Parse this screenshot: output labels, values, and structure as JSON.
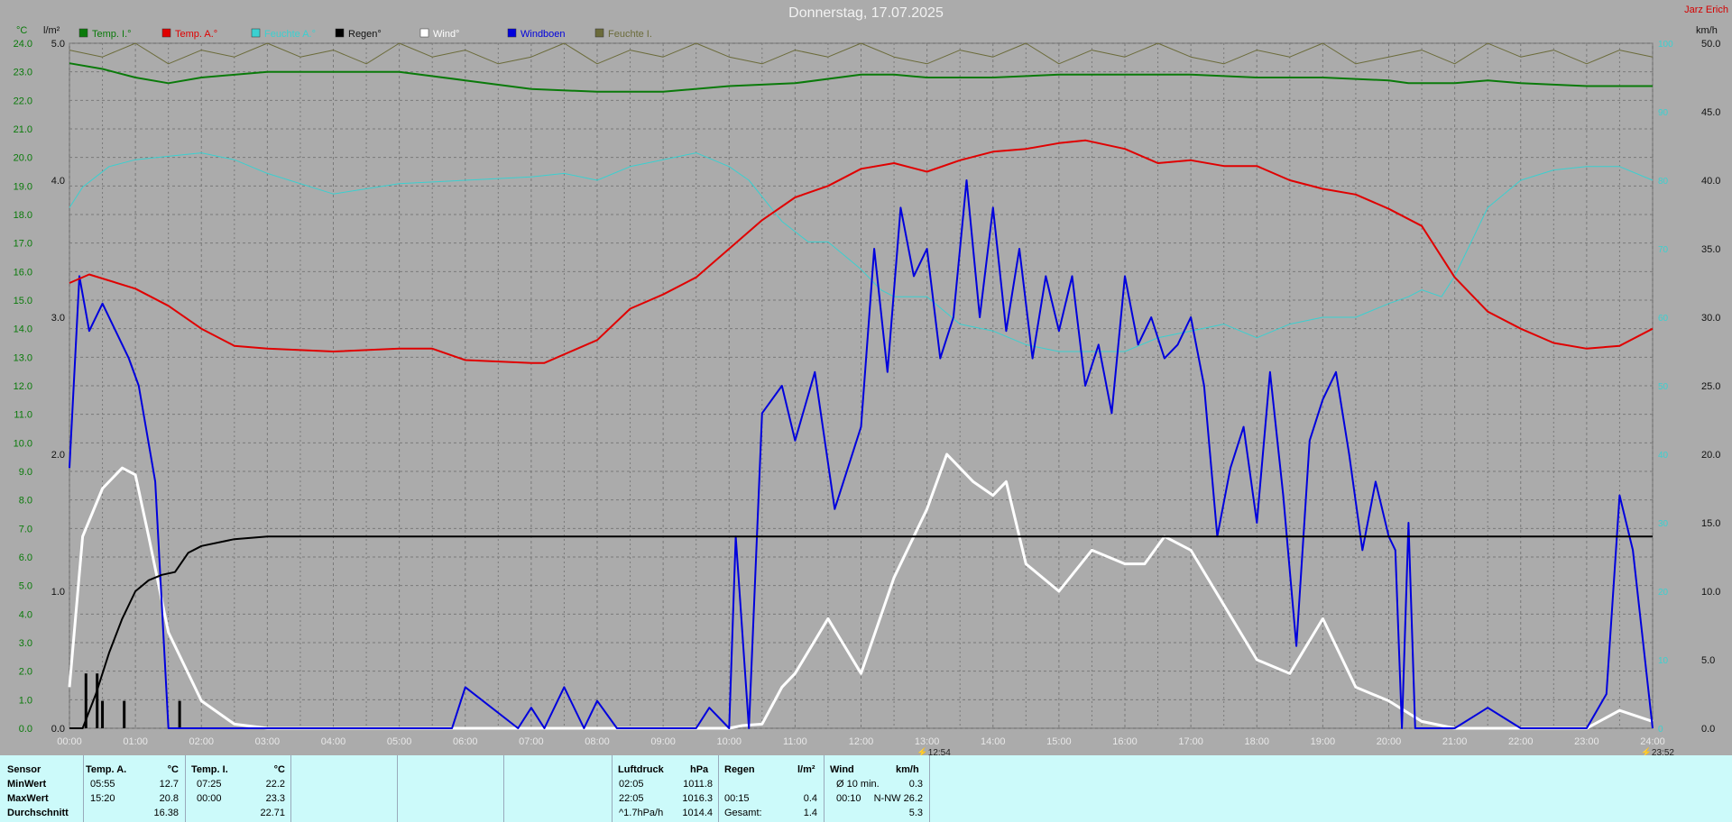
{
  "title": "Donnerstag, 17.07.2025",
  "author": "Jarz Erich",
  "units": {
    "temp": "°C",
    "rain": "l/m²",
    "wind": "km/h"
  },
  "legend": [
    {
      "label": "Temp. I.°",
      "color": "#0a7a0a"
    },
    {
      "label": "Temp. A.°",
      "color": "#e00000"
    },
    {
      "label": "Feuchte A.°",
      "color": "#3ad0d0"
    },
    {
      "label": "Regen°",
      "color": "#000000"
    },
    {
      "label": "Wind°",
      "color": "#ffffff"
    },
    {
      "label": "Windboen",
      "color": "#0000dd"
    },
    {
      "label": "Feuchte I.",
      "color": "#6b6b3a"
    }
  ],
  "markers": {
    "time1": "12:54",
    "time2": "23:52"
  },
  "chart_data": {
    "type": "line",
    "x_ticks": [
      "00:00",
      "01:00",
      "02:00",
      "03:00",
      "04:00",
      "05:00",
      "06:00",
      "07:00",
      "08:00",
      "09:00",
      "10:00",
      "11:00",
      "12:00",
      "13:00",
      "14:00",
      "15:00",
      "16:00",
      "17:00",
      "18:00",
      "19:00",
      "20:00",
      "21:00",
      "22:00",
      "23:00",
      "24:00"
    ],
    "xlim": [
      0,
      24
    ],
    "left_temp_ticks": [
      "0.0",
      "1.0",
      "2.0",
      "3.0",
      "4.0",
      "5.0",
      "6.0",
      "7.0",
      "8.0",
      "9.0",
      "10.0",
      "11.0",
      "12.0",
      "13.0",
      "14.0",
      "15.0",
      "16.0",
      "17.0",
      "18.0",
      "19.0",
      "20.0",
      "21.0",
      "22.0",
      "23.0",
      "24.0"
    ],
    "temp_lim": [
      0,
      24
    ],
    "rain_ticks": [
      "0.0",
      "1.0",
      "2.0",
      "3.0",
      "4.0",
      "5.0"
    ],
    "rain_lim": [
      0,
      5
    ],
    "wind_ticks": [
      "0.0",
      "5.0",
      "10.0",
      "15.0",
      "20.0",
      "25.0",
      "30.0",
      "35.0",
      "40.0",
      "45.0",
      "50.0"
    ],
    "wind_lim": [
      0,
      50
    ],
    "humidity_ticks": [
      "0",
      "10",
      "20",
      "30",
      "40",
      "50",
      "60",
      "70",
      "80",
      "90",
      "100"
    ],
    "series": [
      {
        "name": "Temp. I.°",
        "axis": "temp",
        "color": "#0a7a0a",
        "width": 2,
        "x": [
          0,
          0.5,
          1,
          1.5,
          2,
          3,
          4,
          5,
          6,
          7,
          8,
          9,
          10,
          11,
          12,
          12.5,
          13,
          14,
          15,
          16,
          17,
          18,
          19,
          20,
          20.3,
          21,
          21.5,
          22,
          23,
          24
        ],
        "y": [
          23.3,
          23.1,
          22.8,
          22.6,
          22.8,
          23.0,
          23.0,
          23.0,
          22.7,
          22.4,
          22.3,
          22.3,
          22.5,
          22.6,
          22.9,
          22.9,
          22.8,
          22.8,
          22.9,
          22.9,
          22.9,
          22.8,
          22.8,
          22.7,
          22.6,
          22.6,
          22.7,
          22.6,
          22.5,
          22.5
        ]
      },
      {
        "name": "Temp. A.°",
        "axis": "temp",
        "color": "#e00000",
        "width": 2,
        "x": [
          0,
          0.3,
          1,
          1.5,
          2,
          2.5,
          3,
          4,
          5,
          5.5,
          6,
          7,
          7.2,
          8,
          8.5,
          9,
          9.5,
          10,
          10.5,
          11,
          11.5,
          12,
          12.5,
          13,
          13.5,
          14,
          14.5,
          15,
          15.4,
          16,
          16.5,
          17,
          17.5,
          18,
          18.5,
          19,
          19.5,
          20,
          20.5,
          21,
          21.5,
          22,
          22.5,
          23,
          23.5,
          24
        ],
        "y": [
          15.6,
          15.9,
          15.4,
          14.8,
          14.0,
          13.4,
          13.3,
          13.2,
          13.3,
          13.3,
          12.9,
          12.8,
          12.8,
          13.6,
          14.7,
          15.2,
          15.8,
          16.8,
          17.8,
          18.6,
          19.0,
          19.6,
          19.8,
          19.5,
          19.9,
          20.2,
          20.3,
          20.5,
          20.6,
          20.3,
          19.8,
          19.9,
          19.7,
          19.7,
          19.2,
          18.9,
          18.7,
          18.2,
          17.6,
          15.8,
          14.6,
          14.0,
          13.5,
          13.3,
          13.4,
          14.0
        ]
      },
      {
        "name": "Feuchte A.°",
        "axis": "humidity",
        "color": "#3ad0d0",
        "width": 1,
        "x": [
          0,
          0.2,
          0.6,
          1,
          1.5,
          2,
          2.5,
          3,
          4,
          5,
          6,
          7,
          7.5,
          8,
          8.5,
          9,
          9.5,
          10,
          10.3,
          10.8,
          11.2,
          11.5,
          12,
          12.3,
          12.5,
          13,
          13.5,
          14,
          14.5,
          15,
          15.5,
          16,
          16.5,
          17,
          17.5,
          18,
          18.5,
          19,
          19.5,
          20,
          20.3,
          20.5,
          20.8,
          21,
          21.5,
          22,
          22.5,
          23,
          23.5,
          24
        ],
        "y": [
          76,
          79,
          82,
          83,
          83.5,
          84,
          83,
          81,
          78,
          79.5,
          80,
          80.5,
          81,
          80,
          82,
          83,
          84,
          82,
          80,
          74,
          71,
          71,
          67,
          64,
          63,
          63,
          59,
          58,
          56,
          55,
          55,
          55,
          57,
          58,
          59,
          57,
          59,
          60,
          60,
          62,
          63,
          64,
          63,
          66,
          76,
          80,
          81.5,
          82,
          82,
          80
        ]
      },
      {
        "name": "Feuchte I.",
        "axis": "humidity",
        "color": "#6b6b3a",
        "width": 1,
        "x": [
          0,
          0.5,
          1,
          1.5,
          2,
          2.5,
          3,
          3.5,
          4,
          4.5,
          5,
          5.5,
          6,
          6.5,
          7,
          7.5,
          8,
          8.5,
          9,
          9.5,
          10,
          10.5,
          11,
          11.5,
          12,
          12.5,
          13,
          13.5,
          14,
          14.5,
          15,
          15.5,
          16,
          16.5,
          17,
          17.5,
          18,
          18.5,
          19,
          19.5,
          20,
          20.5,
          21,
          21.5,
          22,
          22.5,
          23,
          23.5,
          24
        ],
        "y": [
          99,
          98,
          100,
          97,
          99,
          98,
          100,
          98,
          99,
          97,
          100,
          98,
          99,
          97,
          98,
          100,
          97,
          99,
          98,
          100,
          98,
          97,
          99,
          98,
          100,
          98,
          97,
          99,
          98,
          100,
          97,
          99,
          98,
          100,
          98,
          97,
          99,
          98,
          100,
          97,
          98,
          99,
          97,
          100,
          98,
          99,
          97,
          99,
          98
        ]
      },
      {
        "name": "Regen°",
        "axis": "rain",
        "color": "#000000",
        "width": 2,
        "x": [
          0,
          0.2,
          0.4,
          0.6,
          0.8,
          1,
          1.2,
          1.4,
          1.6,
          1.8,
          2,
          2.5,
          3,
          4,
          6,
          8,
          10,
          12,
          14,
          16,
          18,
          20,
          22,
          24
        ],
        "y": [
          0,
          0,
          0.25,
          0.55,
          0.8,
          1.0,
          1.08,
          1.12,
          1.14,
          1.28,
          1.33,
          1.38,
          1.4,
          1.4,
          1.4,
          1.4,
          1.4,
          1.4,
          1.4,
          1.4,
          1.4,
          1.4,
          1.4,
          1.4
        ]
      },
      {
        "name": "Wind°",
        "axis": "wind",
        "color": "#ffffff",
        "width": 3,
        "x": [
          0,
          0.2,
          0.5,
          0.8,
          1,
          1.2,
          1.5,
          2,
          2.5,
          3,
          10,
          10.2,
          10.5,
          10.8,
          11,
          11.5,
          12,
          12.5,
          13,
          13.3,
          13.7,
          14,
          14.2,
          14.5,
          15,
          15.5,
          16,
          16.3,
          16.6,
          17,
          17.5,
          18,
          18.5,
          19,
          19.5,
          20,
          20.5,
          21,
          22,
          23,
          23.5,
          24
        ],
        "y": [
          3,
          14,
          17.5,
          19,
          18.5,
          14,
          7,
          2,
          0.3,
          0,
          0,
          0.2,
          0.3,
          3,
          4,
          8,
          4,
          11,
          16,
          20,
          18,
          17,
          18,
          12,
          10,
          13,
          12,
          12,
          14,
          13,
          9,
          5,
          4,
          8,
          3,
          2,
          0.5,
          0,
          0,
          0,
          1.3,
          0.5
        ]
      },
      {
        "name": "Windboen",
        "axis": "wind",
        "color": "#0000dd",
        "width": 2,
        "x": [
          0,
          0.15,
          0.3,
          0.5,
          0.7,
          0.9,
          1.05,
          1.3,
          1.5,
          1.7,
          1.8,
          2,
          5,
          5.8,
          6,
          6.8,
          7,
          7.2,
          7.5,
          7.8,
          8,
          8.3,
          9.5,
          9.7,
          10,
          10.1,
          10.3,
          10.5,
          10.8,
          11,
          11.3,
          11.6,
          12,
          12.2,
          12.4,
          12.6,
          12.8,
          13,
          13.2,
          13.4,
          13.6,
          13.8,
          14,
          14.2,
          14.4,
          14.6,
          14.8,
          15,
          15.2,
          15.4,
          15.6,
          15.8,
          16,
          16.2,
          16.4,
          16.6,
          16.8,
          17,
          17.2,
          17.4,
          17.6,
          17.8,
          18,
          18.2,
          18.4,
          18.6,
          18.8,
          19,
          19.2,
          19.4,
          19.6,
          19.8,
          20,
          20.1,
          20.2,
          20.3,
          20.4,
          21,
          21.5,
          22,
          23,
          23.3,
          23.5,
          23.7,
          24
        ],
        "y": [
          19,
          33,
          29,
          31,
          29,
          27,
          25,
          18,
          0,
          0,
          0,
          0,
          0,
          0,
          3,
          0,
          1.5,
          0,
          3,
          0,
          2,
          0,
          0,
          1.5,
          0,
          14,
          0,
          23,
          25,
          21,
          26,
          16,
          22,
          35,
          26,
          38,
          33,
          35,
          27,
          30,
          40,
          30,
          38,
          29,
          35,
          27,
          33,
          29,
          33,
          25,
          28,
          23,
          33,
          28,
          30,
          27,
          28,
          30,
          25,
          14,
          19,
          22,
          15,
          26,
          17,
          6,
          21,
          24,
          26,
          20,
          13,
          18,
          14,
          13,
          0,
          15,
          0,
          0,
          1.5,
          0,
          0,
          2.5,
          17,
          13,
          0
        ]
      }
    ]
  },
  "table": {
    "headers": {
      "sensor": "Sensor",
      "temp_a": "Temp. A.",
      "temp_a_unit": "°C",
      "temp_i": "Temp. I.",
      "temp_i_unit": "°C",
      "luftdruck": "Luftdruck",
      "luftdruck_unit": "hPa",
      "regen": "Regen",
      "regen_unit": "l/m²",
      "wind": "Wind",
      "wind_unit": "km/h"
    },
    "rows": [
      {
        "label": "MinWert",
        "ta_time": "05:55",
        "ta_val": "12.7",
        "ti_time": "07:25",
        "ti_val": "22.2",
        "p_time": "02:05",
        "p_val": "1011.8",
        "r_time": "",
        "r_val": "",
        "w_time": "Ø 10 min.",
        "w_val": "0.3"
      },
      {
        "label": "MaxWert",
        "ta_time": "15:20",
        "ta_val": "20.8",
        "ti_time": "00:00",
        "ti_val": "23.3",
        "p_time": "22:05",
        "p_val": "1016.3",
        "r_time": "00:15",
        "r_val": "0.4",
        "w_time": "00:10",
        "w_val": "N-NW 26.2"
      },
      {
        "label": "Durchschnitt",
        "ta_time": "",
        "ta_val": "16.38",
        "ti_time": "",
        "ti_val": "22.71",
        "p_time": "^1.7hPa/h",
        "p_val": "1014.4",
        "r_time": "Gesamt:",
        "r_val": "1.4",
        "w_time": "",
        "w_val": "5.3"
      }
    ]
  }
}
